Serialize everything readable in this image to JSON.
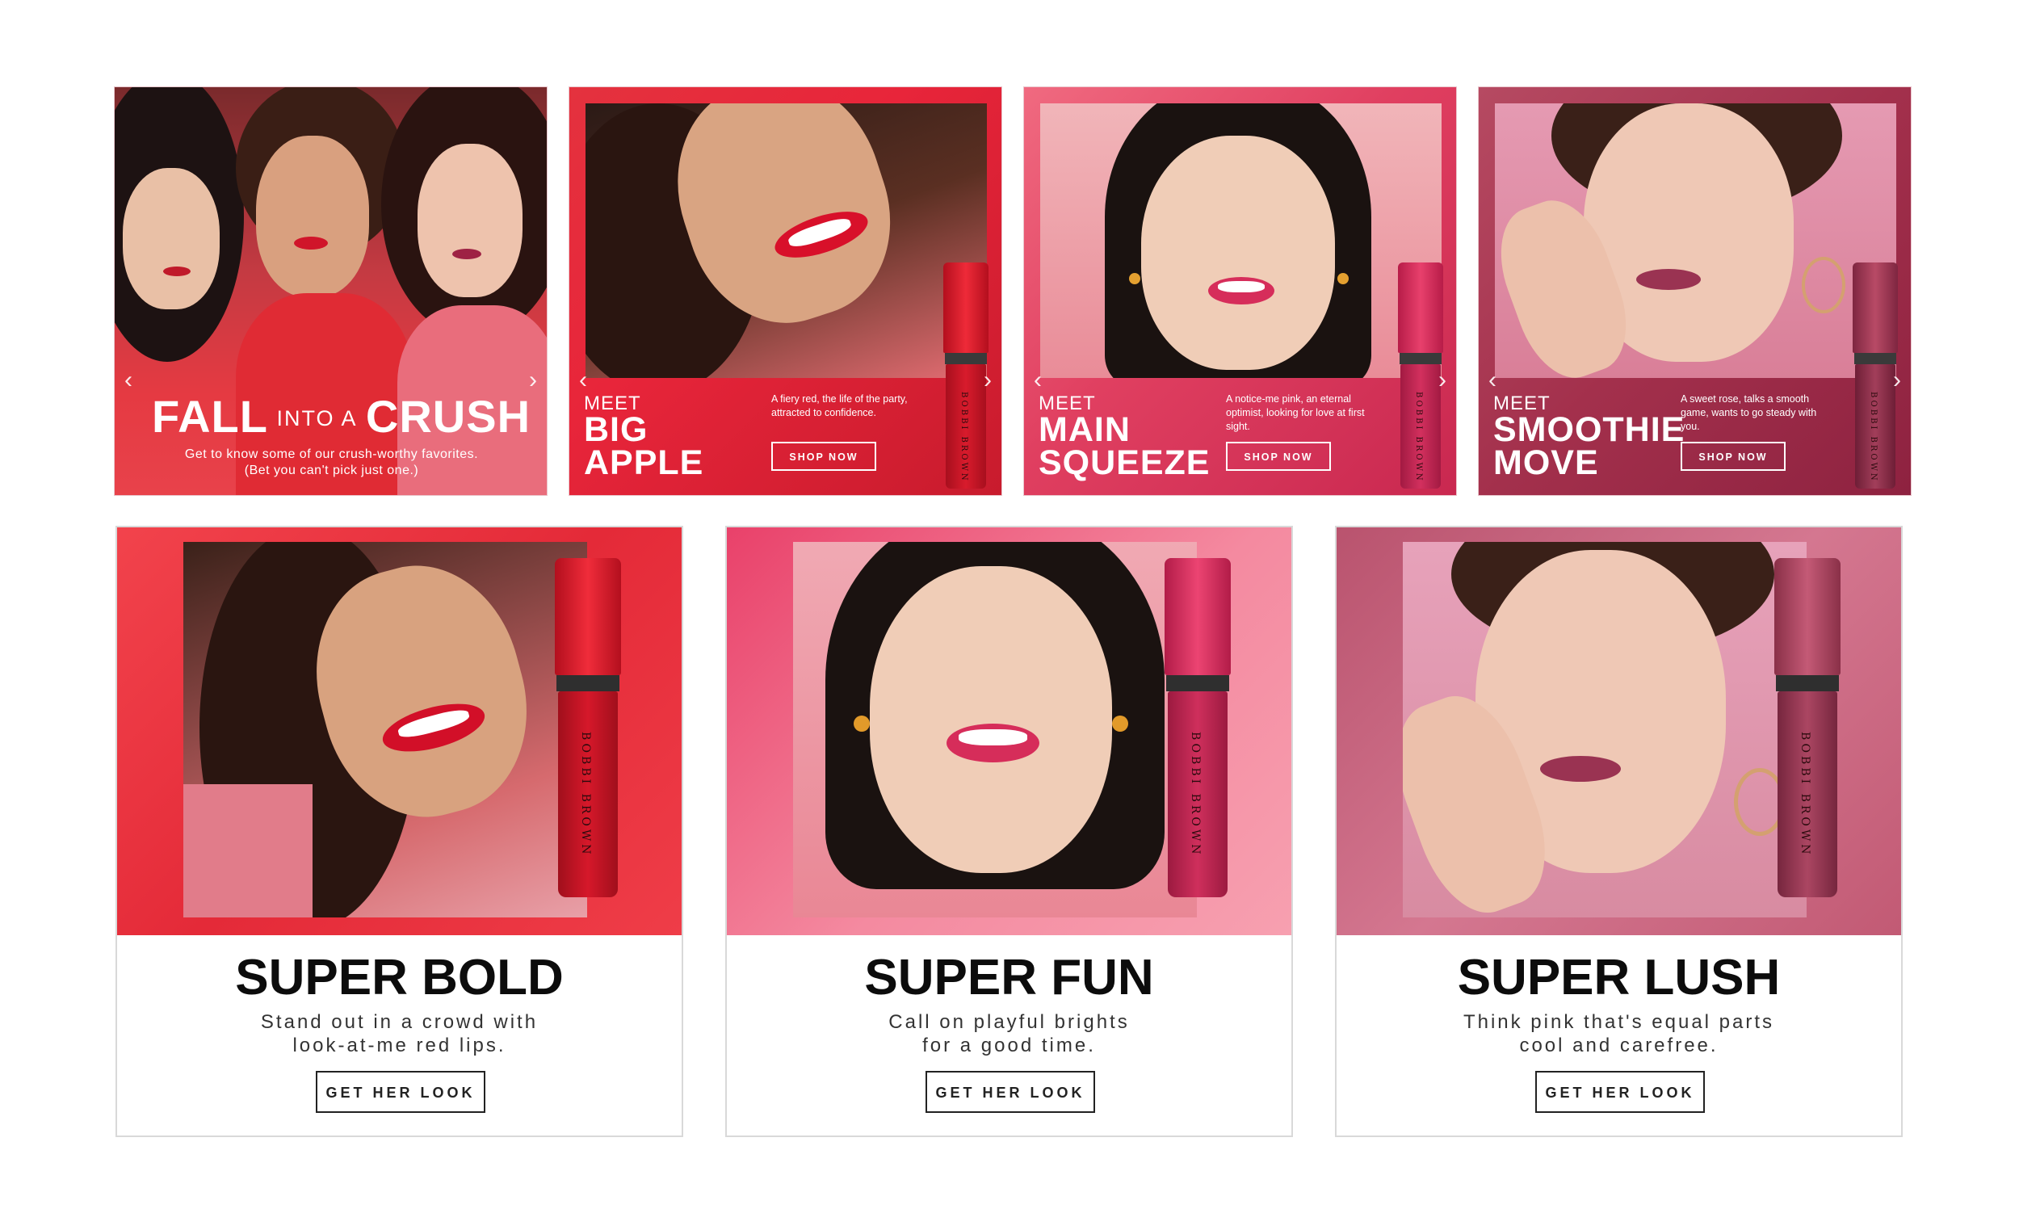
{
  "banners": [
    {
      "headline_big1": "FALL",
      "headline_small": "INTO A",
      "headline_big2": "CRUSH",
      "line1": "Get to know some of our crush-worthy favorites.",
      "line2": "(Bet you can't pick just one.)",
      "prev_icon": "chevron-left-icon",
      "next_icon": "chevron-right-icon"
    },
    {
      "meet": "MEET",
      "name_line1": "BIG",
      "name_line2": "APPLE",
      "blurb": "A fiery red, the life of the party, attracted to confidence.",
      "shop": "SHOP NOW",
      "brand": "BOBBI BROWN"
    },
    {
      "meet": "MEET",
      "name_line1": "MAIN",
      "name_line2": "SQUEEZE",
      "blurb": "A notice-me pink, an eternal optimist, looking for love at first sight.",
      "shop": "SHOP NOW",
      "brand": "BOBBI BROWN"
    },
    {
      "meet": "MEET",
      "name_line1": "SMOOTHIE",
      "name_line2": "MOVE",
      "blurb": "A sweet rose, talks a smooth game, wants to go steady with you.",
      "shop": "SHOP NOW",
      "brand": "BOBBI BROWN"
    }
  ],
  "cards": [
    {
      "title": "SUPER BOLD",
      "sub1": "Stand out in a crowd with",
      "sub2": "look-at-me red lips.",
      "cta": "GET HER LOOK",
      "brand": "BOBBI BROWN"
    },
    {
      "title": "SUPER FUN",
      "sub1": "Call on playful brights",
      "sub2": "for a good time.",
      "cta": "GET HER LOOK",
      "brand": "BOBBI BROWN"
    },
    {
      "title": "SUPER LUSH",
      "sub1": "Think pink that's equal parts",
      "sub2": "cool and carefree.",
      "cta": "GET HER LOOK",
      "brand": "BOBBI BROWN"
    }
  ],
  "colors": {
    "red": "#e8232f",
    "pink": "#e0436a",
    "rose": "#a8304e",
    "skin": "#e9b9a1",
    "hair": "#2a1512"
  }
}
